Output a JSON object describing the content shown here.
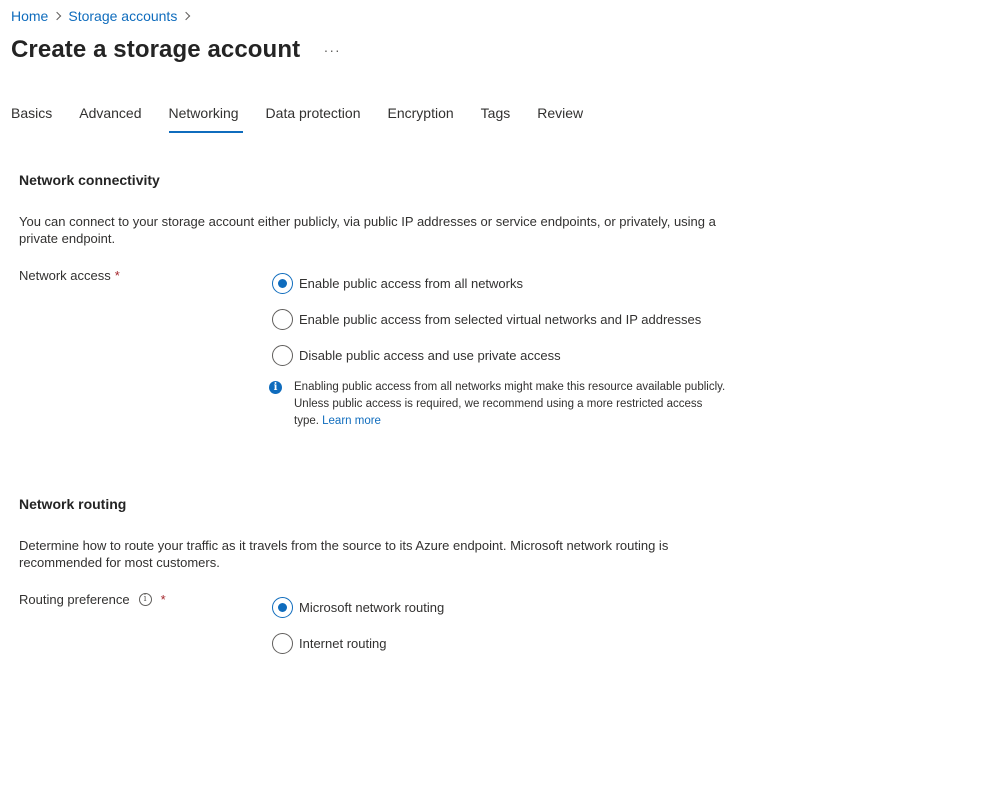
{
  "breadcrumb": {
    "items": [
      "Home",
      "Storage accounts"
    ]
  },
  "page": {
    "title": "Create a storage account",
    "more_label": "···"
  },
  "tabs": [
    "Basics",
    "Advanced",
    "Networking",
    "Data protection",
    "Encryption",
    "Tags",
    "Review"
  ],
  "active_tab": "Networking",
  "network_connectivity": {
    "heading": "Network connectivity",
    "description": "You can connect to your storage account either publicly, via public IP addresses or service endpoints, or privately, using a private endpoint.",
    "field_label": "Network access",
    "required_mark": "*",
    "options": [
      "Enable public access from all networks",
      "Enable public access from selected virtual networks and IP addresses",
      "Disable public access and use private access"
    ],
    "selected_index": 0,
    "info_message": "Enabling public access from all networks might make this resource available publicly. Unless public access is required, we recommend using a more restricted access type.",
    "info_link": "Learn more",
    "info_icon": "info-filled-icon"
  },
  "network_routing": {
    "heading": "Network routing",
    "description": "Determine how to route your traffic as it travels from the source to its Azure endpoint. Microsoft network routing is recommended for most customers.",
    "field_label": "Routing preference",
    "required_mark": "*",
    "info_icon": "info-outline-icon",
    "options": [
      "Microsoft network routing",
      "Internet routing"
    ],
    "selected_index": 0
  },
  "colors": {
    "accent": "#0f6cbd",
    "required": "#a4262c",
    "text": "#323130"
  }
}
